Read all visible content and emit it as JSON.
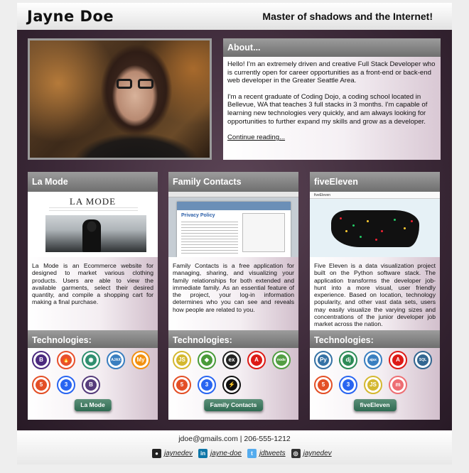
{
  "header": {
    "name": "Jayne Doe",
    "tagline": "Master of shadows and the Internet!"
  },
  "about": {
    "heading": "About...",
    "paragraph1": "Hello! I'm an extremely driven and creative Full Stack Developer who is currently open for career opportunities as a front-end or back-end web developer in the Greater Seattle Area.",
    "paragraph2": "I'm a recent graduate of Coding Dojo, a coding school located in Bellevue, WA that teaches 3 full stacks in 3 months. I'm capable of learning new technologies very quickly, and am always looking for opportunities to further expand my skills and grow as a developer.",
    "continue_link": "Continue reading..."
  },
  "projects": [
    {
      "title": "La Mode",
      "screenshot_title": "LA MODE",
      "description": "La Mode is an Ecommerce website for designed to market various clothing products. Users are able to view the available garments, select their desired quantity, and compile a shopping cart for making a final purchase.",
      "tech_heading": "Technologies:",
      "button": "La Mode",
      "technologies": [
        {
          "name": "bootstrap-icon",
          "glyph": "B",
          "color": "#4b2a7f"
        },
        {
          "name": "codeigniter-icon",
          "glyph": "🔥",
          "color": "#e8502c"
        },
        {
          "name": "mysql-workbench-icon",
          "glyph": "◉",
          "color": "#2f8f6f"
        },
        {
          "name": "ajax-icon",
          "glyph": "AJAX",
          "color": "#3a7fc0"
        },
        {
          "name": "mysql-icon",
          "glyph": "My",
          "color": "#f29111"
        },
        {
          "name": "html5-icon",
          "glyph": "5",
          "color": "#e34f26"
        },
        {
          "name": "css3-icon",
          "glyph": "3",
          "color": "#2965f1"
        },
        {
          "name": "bootstrap-b-icon",
          "glyph": "B",
          "color": "#563d7c"
        }
      ]
    },
    {
      "title": "Family Contacts",
      "screenshot_title": "Privacy Policy",
      "description": "Family Contacts is a free application for managing, sharing, and visualizing your family relationships for both extended and immediate family. As an essential feature of the project, your log-in information determines who you can see and reveals how people are related to you.",
      "tech_heading": "Technologies:",
      "button": "Family Contacts",
      "technologies": [
        {
          "name": "javascript-icon",
          "glyph": "JS",
          "color": "#d4b830"
        },
        {
          "name": "mongodb-icon",
          "glyph": "◆",
          "color": "#4a9b3a"
        },
        {
          "name": "express-icon",
          "glyph": "ex",
          "color": "#222222"
        },
        {
          "name": "angular-icon",
          "glyph": "A",
          "color": "#dd1b16"
        },
        {
          "name": "nodejs-icon",
          "glyph": "node",
          "color": "#539e43"
        },
        {
          "name": "html5-icon",
          "glyph": "5",
          "color": "#e34f26"
        },
        {
          "name": "css3-icon",
          "glyph": "3",
          "color": "#2965f1"
        },
        {
          "name": "d3-icon",
          "glyph": "⚡",
          "color": "#111111"
        }
      ]
    },
    {
      "title": "fiveEleven",
      "screenshot_title": "fiveEleven",
      "description": "Five Eleven is a data visualization project built on the Python software stack. The application transforms the developer job-hunt into a more visual, user friendly experience. Based on location, technology popularity, and other vast data sets, users may easily visualize the varying sizes and concentrations of the junior developer job market across the nation.",
      "tech_heading": "Technologies:",
      "button": "fiveEleven",
      "technologies": [
        {
          "name": "python-icon",
          "glyph": "Py",
          "color": "#3572a5"
        },
        {
          "name": "django-icon",
          "glyph": "dj",
          "color": "#2e8b57"
        },
        {
          "name": "ajax-icon",
          "glyph": "ajax",
          "color": "#3a7fc0"
        },
        {
          "name": "angular-icon",
          "glyph": "A",
          "color": "#dd1b16"
        },
        {
          "name": "sqlite-icon",
          "glyph": "SQL",
          "color": "#336791"
        },
        {
          "name": "html5-icon",
          "glyph": "5",
          "color": "#e34f26"
        },
        {
          "name": "css3-icon",
          "glyph": "3",
          "color": "#2965f1"
        },
        {
          "name": "javascript-icon",
          "glyph": "JS",
          "color": "#d4b830"
        },
        {
          "name": "materialize-icon",
          "glyph": "m",
          "color": "#ee6e73"
        }
      ]
    }
  ],
  "footer": {
    "contact": "jdoe@gmails.com | 206-555-1212",
    "social": [
      {
        "icon": "github-icon",
        "handle": "jaynedev",
        "color": "#222222",
        "glyph": "●"
      },
      {
        "icon": "linkedin-icon",
        "handle": "jayne-doe",
        "color": "#0e76a8",
        "glyph": "in"
      },
      {
        "icon": "twitter-icon",
        "handle": "jdtweets",
        "color": "#55acee",
        "glyph": "t"
      },
      {
        "icon": "codepen-icon",
        "handle": "jaynedev",
        "color": "#333333",
        "glyph": "◎"
      }
    ]
  }
}
